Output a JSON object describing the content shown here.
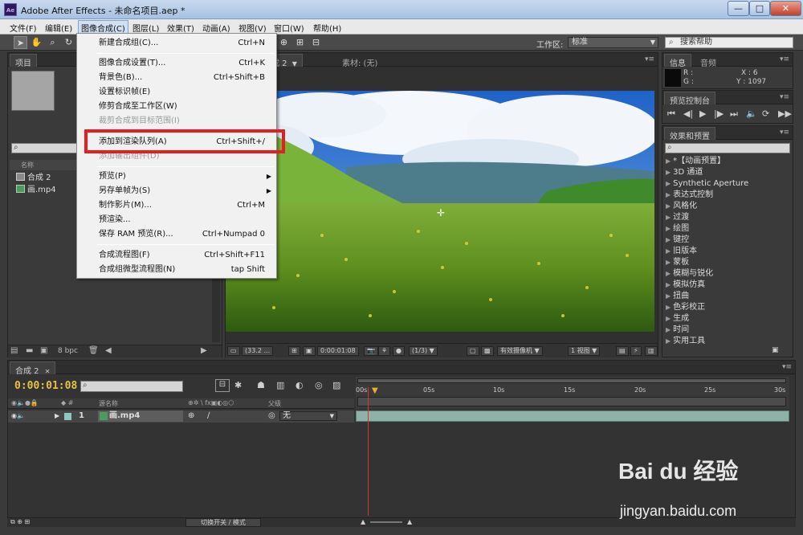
{
  "window": {
    "app_icon": "Ae",
    "title": "Adobe After Effects - 未命名项目.aep *",
    "minimize": "—",
    "maximize": "□",
    "close": "✕"
  },
  "menubar": [
    "文件(F)",
    "编辑(E)",
    "图像合成(C)",
    "图层(L)",
    "效果(T)",
    "动画(A)",
    "视图(V)",
    "窗口(W)",
    "帮助(H)"
  ],
  "toolbar": {
    "workspace_label": "工作区:",
    "workspace_value": "标准",
    "help_search": "搜索帮助"
  },
  "comp_menu": [
    {
      "label": "新建合成组(C)...",
      "shortcut": "Ctrl+N",
      "disabled": false
    },
    {
      "label": "图像合成设置(T)...",
      "shortcut": "Ctrl+K",
      "disabled": false
    },
    {
      "label": "背景色(B)...",
      "shortcut": "Ctrl+Shift+B",
      "disabled": false
    },
    {
      "label": "设置标识帧(E)",
      "shortcut": "",
      "disabled": false
    },
    {
      "label": "修剪合成至工作区(W)",
      "shortcut": "",
      "disabled": false
    },
    {
      "label": "裁剪合成到目标范围(I)",
      "shortcut": "",
      "disabled": true
    },
    {
      "label": "添加到渲染队列(A)",
      "shortcut": "Ctrl+Shift+/",
      "disabled": false
    },
    {
      "label": "添加输出组件(D)",
      "shortcut": "",
      "disabled": true
    },
    {
      "label": "预览(P)",
      "shortcut": "",
      "disabled": false
    },
    {
      "label": "另存单帧为(S)",
      "shortcut": "",
      "disabled": false
    },
    {
      "label": "制作影片(M)...",
      "shortcut": "Ctrl+M",
      "disabled": false
    },
    {
      "label": "预渲染...",
      "shortcut": "",
      "disabled": false
    },
    {
      "label": "保存 RAM 预览(R)...",
      "shortcut": "Ctrl+Numpad 0",
      "disabled": false
    },
    {
      "label": "合成流程图(F)",
      "shortcut": "Ctrl+Shift+F11",
      "disabled": false
    },
    {
      "label": "合成组微型流程图(N)",
      "shortcut": "tap Shift",
      "disabled": false
    }
  ],
  "project_panel": {
    "tab": "项目",
    "column_name": "名称",
    "items": [
      "合成 2",
      "画.mp4"
    ],
    "bit_depth": "8 bpc"
  },
  "viewer_panel": {
    "comp_tab": "成 2",
    "footage_tab": "素材: (无)",
    "zoom": "(33.2 ...",
    "timecode": "0:00:01:08",
    "resolution": "(1/3)",
    "camera": "有效摄像机",
    "views": "1 视图"
  },
  "info_panel": {
    "tab_info": "信息",
    "tab_audio": "音频",
    "r_label": "R :",
    "g_label": "G :",
    "x": "X : 6",
    "y": "Y : 1097"
  },
  "preview_panel": {
    "tab": "预览控制台"
  },
  "effects_panel": {
    "tab": "效果和预置",
    "items": [
      "*【动画预置】",
      "3D 通道",
      "Synthetic Aperture",
      "表达式控制",
      "风格化",
      "过渡",
      "绘图",
      "键控",
      "旧版本",
      "蒙板",
      "模糊与锐化",
      "模拟仿真",
      "扭曲",
      "色彩校正",
      "生成",
      "时间",
      "实用工具"
    ]
  },
  "timeline": {
    "tab": "合成 2",
    "timecode": "0:00:01:08",
    "col_source": "源名称",
    "col_parent": "父级",
    "layer_number": "1",
    "layer_name": "画.mp4",
    "layer_parent": "无",
    "ruler_labels": [
      "00s",
      "05s",
      "10s",
      "15s",
      "20s",
      "25s",
      "30s"
    ],
    "toggle_label": "切换开关 / 模式"
  },
  "watermark": {
    "logo": "Bai du 经验",
    "url": "jingyan.baidu.com"
  }
}
